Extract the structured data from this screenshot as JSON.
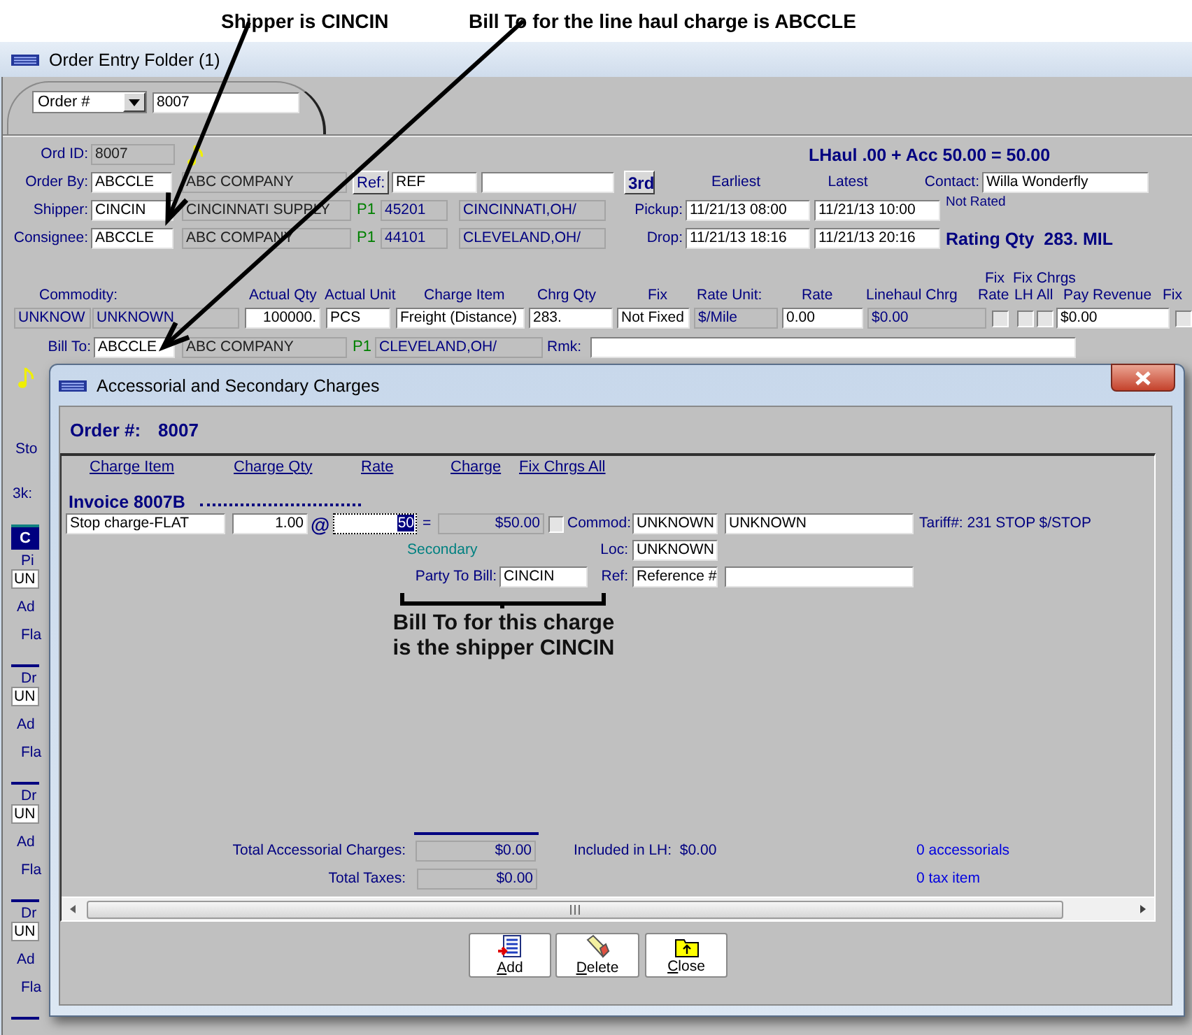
{
  "annotations": {
    "shipper_note": "Shipper is CINCIN",
    "bill_to_note": "Bill To for the line haul charge is ABCCLE",
    "charge_note": [
      "Bill To for this charge",
      "is the shipper CINCIN"
    ]
  },
  "window": {
    "title": "Order Entry Folder (1)"
  },
  "lookup": {
    "field": "Order #",
    "value": "8007"
  },
  "order": {
    "ord_id_label": "Ord ID:",
    "ord_id": "8007",
    "summary": "LHaul .00 + Acc 50.00 = 50.00",
    "order_by_label": "Order By:",
    "order_by_code": "ABCCLE",
    "order_by_name": "ABC COMPANY",
    "ref_button": "Ref:",
    "ref_value": "REF",
    "third_button": "3rd",
    "earliest": "Earliest",
    "latest": "Latest",
    "contact_label": "Contact:",
    "contact": "Willa Wonderfly"
  },
  "parties": [
    {
      "label": "Shipper:",
      "code": "CINCIN",
      "name": "CINCINNATI SUPPLY",
      "priority": "P1",
      "zip": "45201",
      "city": "CINCINNATI,OH/",
      "time_label": "Pickup:",
      "earliest": "11/21/13 08:00",
      "latest": "11/21/13 10:00",
      "note": "Not Rated",
      "kind": "status"
    },
    {
      "label": "Consignee:",
      "code": "ABCCLE",
      "name": "ABC COMPANY",
      "priority": "P1",
      "zip": "44101",
      "city": "CLEVELAND,OH/",
      "time_label": "Drop:",
      "earliest": "11/21/13 18:16",
      "latest": "11/21/13 20:16",
      "note": "Rating Qty  283. MIL",
      "kind": "rating"
    }
  ],
  "line_haul": {
    "upper_headers": [
      "Fix",
      "Fix Chrgs"
    ],
    "headers": [
      "Commodity:",
      "Actual Qty",
      "Actual Unit",
      "Charge Item",
      "Chrg Qty",
      "Fix",
      "Rate Unit:",
      "Rate",
      "Linehaul Chrg",
      "Rate",
      "LH",
      "All",
      "Pay Revenue",
      "Fix"
    ],
    "commodity_code": "UNKNOW",
    "commodity_name": "UNKNOWN",
    "actual_qty": "100000.",
    "actual_unit": "PCS",
    "charge_item": "Freight (Distance)",
    "chrg_qty": "283.",
    "fix": "Not Fixed",
    "rate_unit": "$/Mile",
    "rate": "0.00",
    "linehaul_chrg": "$0.00",
    "fix_rate": false,
    "fix_lh": false,
    "fix_all": false,
    "pay_revenue": "$0.00",
    "fix_revenue": false,
    "bill_to_label": "Bill To:",
    "bill_to_code": "ABCCLE",
    "bill_to_name": "ABC COMPANY",
    "bill_to_priority": "P1",
    "bill_to_city": "CLEVELAND,OH/",
    "remark_label": "Rmk:"
  },
  "covered_panel": {
    "stop_label": "Sto",
    "code_label": "3k:",
    "grid_header": "C",
    "stops": [
      {
        "type": "Pi",
        "value": "UN",
        "line_3": "Ad",
        "line_4": "Fla"
      },
      {
        "type": "Dr",
        "value": "UN",
        "line_3": "Ad",
        "line_4": "Fla"
      },
      {
        "type": "Dr",
        "value": "UN",
        "line_3": "Ad",
        "line_4": "Fla"
      },
      {
        "type": "Dr",
        "value": "UN",
        "line_3": "Ad",
        "line_4": "Fla"
      }
    ]
  },
  "dialog": {
    "title": "Accessorial and Secondary Charges",
    "order_label": "Order #:",
    "order_value": "8007",
    "columns": [
      "Charge Item",
      "Charge Qty",
      "Rate",
      "Charge",
      "Fix Chrgs All"
    ],
    "invoice": "Invoice 8007B",
    "charges": [
      {
        "charge_item": "Stop charge-FLAT",
        "qty": "1.00",
        "at": "@",
        "rate": "50",
        "equals": "=",
        "charge": "$50.00",
        "fixed": false,
        "commod_label": "Commod:",
        "commod_code": "UNKNOWN",
        "commod_name": "UNKNOWN",
        "tariff": "Tariff#: 231 STOP $/STOP",
        "type": "Secondary",
        "loc_label": "Loc:",
        "loc": "UNKNOWN",
        "party_label": "Party To Bill:",
        "party": "CINCIN",
        "ref_label": "Ref:",
        "ref": "Reference #"
      }
    ],
    "totals": [
      {
        "label": "Total Accessorial Charges:",
        "value": "$0.00"
      },
      {
        "label": "Total Taxes:",
        "value": "$0.00"
      }
    ],
    "included": "Included in LH:  $0.00",
    "counts": [
      "0 accessorials",
      "0 tax item"
    ],
    "buttons": [
      {
        "label": "Add",
        "kind": "add"
      },
      {
        "label": "Delete",
        "kind": "delete"
      },
      {
        "label": "Close",
        "kind": "close"
      }
    ]
  }
}
